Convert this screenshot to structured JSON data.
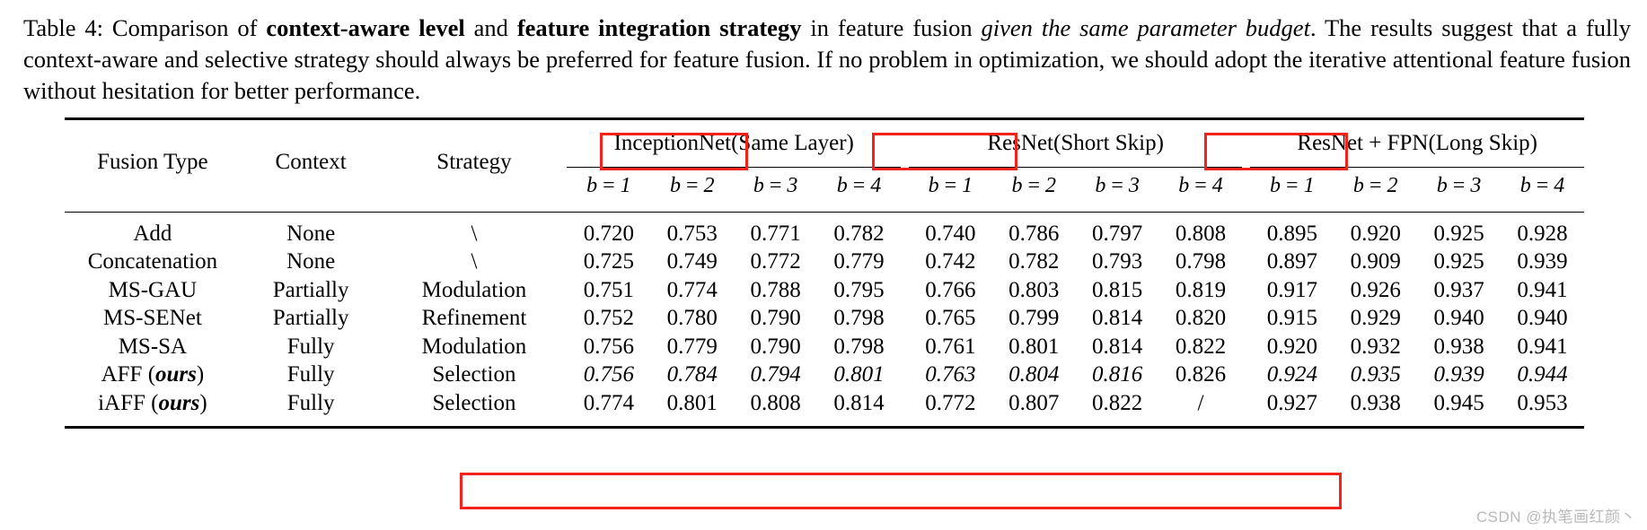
{
  "caption": {
    "label": "Table 4:",
    "part1": " Comparison of ",
    "bold1": "context-aware level",
    "part2": " and ",
    "bold2": "feature integration strategy",
    "part3": " in feature fusion ",
    "italic1": "given the same parameter budget",
    "part4": ". The results suggest that a fully context-aware and selective strategy should always be preferred for feature fusion. If no problem in optimization, we should adopt the iterative attentional feature fusion without hesitation for better performance."
  },
  "table": {
    "row_headers": [
      "Fusion Type",
      "Context",
      "Strategy"
    ],
    "groups": [
      {
        "name": "InceptionNet",
        "annotation": "(Same Layer)"
      },
      {
        "name": "ResNet",
        "annotation": "(Short Skip)"
      },
      {
        "name": "ResNet + FPN",
        "annotation": "(Long Skip)"
      }
    ],
    "budget_symbol": "b",
    "budget_eq": "=",
    "budget_levels": [
      "1",
      "2",
      "3",
      "4"
    ],
    "rows": [
      {
        "fusion_type": "Add",
        "context": "None",
        "strategy": "\\",
        "values": [
          "0.720",
          "0.753",
          "0.771",
          "0.782",
          "0.740",
          "0.786",
          "0.797",
          "0.808",
          "0.895",
          "0.920",
          "0.925",
          "0.928"
        ],
        "style": "normal",
        "bold_indices": []
      },
      {
        "fusion_type": "Concatenation",
        "context": "None",
        "strategy": "\\",
        "values": [
          "0.725",
          "0.749",
          "0.772",
          "0.779",
          "0.742",
          "0.782",
          "0.793",
          "0.798",
          "0.897",
          "0.909",
          "0.925",
          "0.939"
        ],
        "style": "normal",
        "bold_indices": []
      },
      {
        "fusion_type": "MS-GAU",
        "context": "Partially",
        "strategy": "Modulation",
        "values": [
          "0.751",
          "0.774",
          "0.788",
          "0.795",
          "0.766",
          "0.803",
          "0.815",
          "0.819",
          "0.917",
          "0.926",
          "0.937",
          "0.941"
        ],
        "style": "normal",
        "bold_indices": []
      },
      {
        "fusion_type": "MS-SENet",
        "context": "Partially",
        "strategy": "Refinement",
        "values": [
          "0.752",
          "0.780",
          "0.790",
          "0.798",
          "0.765",
          "0.799",
          "0.814",
          "0.820",
          "0.915",
          "0.929",
          "0.940",
          "0.940"
        ],
        "style": "normal",
        "bold_indices": []
      },
      {
        "fusion_type": "MS-SA",
        "context": "Fully",
        "strategy": "Modulation",
        "values": [
          "0.756",
          "0.779",
          "0.790",
          "0.798",
          "0.761",
          "0.801",
          "0.814",
          "0.822",
          "0.920",
          "0.932",
          "0.938",
          "0.941"
        ],
        "style": "normal",
        "bold_indices": []
      },
      {
        "fusion_type": "AFF (ours)",
        "fusion_type_pre": "AFF (",
        "fusion_type_em": "ours",
        "fusion_type_post": ")",
        "context": "Fully",
        "strategy": "Selection",
        "values": [
          "0.756",
          "0.784",
          "0.794",
          "0.801",
          "0.763",
          "0.804",
          "0.816",
          "0.826",
          "0.924",
          "0.935",
          "0.939",
          "0.944"
        ],
        "style": "italic",
        "bold_indices": [
          7
        ]
      },
      {
        "fusion_type": "iAFF (ours)",
        "fusion_type_pre": "iAFF (",
        "fusion_type_em": "ours",
        "fusion_type_post": ")",
        "context": "Fully",
        "strategy": "Selection",
        "values": [
          "0.774",
          "0.801",
          "0.808",
          "0.814",
          "0.772",
          "0.807",
          "0.822",
          "/",
          "0.927",
          "0.938",
          "0.945",
          "0.953"
        ],
        "style": "bold",
        "bold_indices": []
      }
    ]
  },
  "annotations": {
    "highlight_color": "#f5221b",
    "boxes": [
      "(Same Layer)",
      "(Short Skip)",
      "(Long Skip)",
      "iAFF row"
    ]
  },
  "watermark": {
    "text": "CSDN @执笔画红颜丶"
  }
}
